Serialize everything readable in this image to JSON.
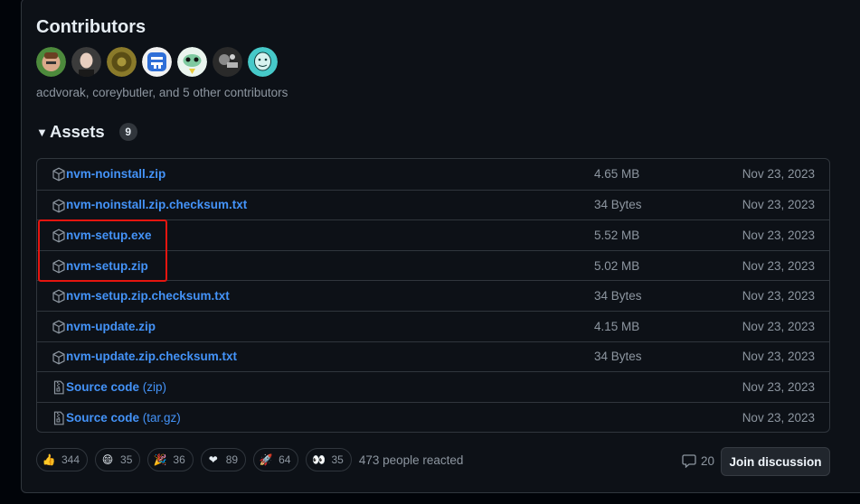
{
  "contributors": {
    "title": "Contributors",
    "summary": "acdvorak, coreybutler, and 5 other contributors",
    "avatars": [
      {
        "name": "avatar-1",
        "color": "#4d8a3c"
      },
      {
        "name": "avatar-2",
        "color": "#e9e9e9"
      },
      {
        "name": "avatar-3",
        "color": "#8a7a2a"
      },
      {
        "name": "avatar-4",
        "color": "#2f6fd8"
      },
      {
        "name": "avatar-5",
        "color": "#c9e7d0"
      },
      {
        "name": "avatar-6",
        "color": "#555555"
      },
      {
        "name": "avatar-7",
        "color": "#46c9c9"
      }
    ]
  },
  "assets": {
    "title": "Assets",
    "count": "9",
    "items": [
      {
        "name": "nvm-noinstall.zip",
        "extra": "",
        "size": "4.65 MB",
        "date": "Nov 23, 2023",
        "icon": "package-icon"
      },
      {
        "name": "nvm-noinstall.zip.checksum.txt",
        "extra": "",
        "size": "34 Bytes",
        "date": "Nov 23, 2023",
        "icon": "package-icon"
      },
      {
        "name": "nvm-setup.exe",
        "extra": "",
        "size": "5.52 MB",
        "date": "Nov 23, 2023",
        "icon": "package-icon"
      },
      {
        "name": "nvm-setup.zip",
        "extra": "",
        "size": "5.02 MB",
        "date": "Nov 23, 2023",
        "icon": "package-icon"
      },
      {
        "name": "nvm-setup.zip.checksum.txt",
        "extra": "",
        "size": "34 Bytes",
        "date": "Nov 23, 2023",
        "icon": "package-icon"
      },
      {
        "name": "nvm-update.zip",
        "extra": "",
        "size": "4.15 MB",
        "date": "Nov 23, 2023",
        "icon": "package-icon"
      },
      {
        "name": "nvm-update.zip.checksum.txt",
        "extra": "",
        "size": "34 Bytes",
        "date": "Nov 23, 2023",
        "icon": "package-icon"
      },
      {
        "name": "Source code",
        "extra": " (zip)",
        "size": "",
        "date": "Nov 23, 2023",
        "icon": "file-zip-icon"
      },
      {
        "name": "Source code",
        "extra": " (tar.gz)",
        "size": "",
        "date": "Nov 23, 2023",
        "icon": "file-zip-icon"
      }
    ]
  },
  "reactions": {
    "items": [
      {
        "emoji": "👍",
        "name": "thumbs-up",
        "count": "344"
      },
      {
        "emoji": "😄",
        "name": "laugh",
        "count": "35"
      },
      {
        "emoji": "🎉",
        "name": "hooray",
        "count": "36"
      },
      {
        "emoji": "❤",
        "name": "heart",
        "count": "89"
      },
      {
        "emoji": "🚀",
        "name": "rocket",
        "count": "64"
      },
      {
        "emoji": "👀",
        "name": "eyes",
        "count": "35"
      }
    ],
    "summary": "473 people reacted"
  },
  "discussion": {
    "comment_count": "20",
    "join_label": "Join discussion"
  },
  "colors": {
    "link": "#4493f8",
    "muted": "#8d96a0",
    "highlight": "#e5150f"
  }
}
